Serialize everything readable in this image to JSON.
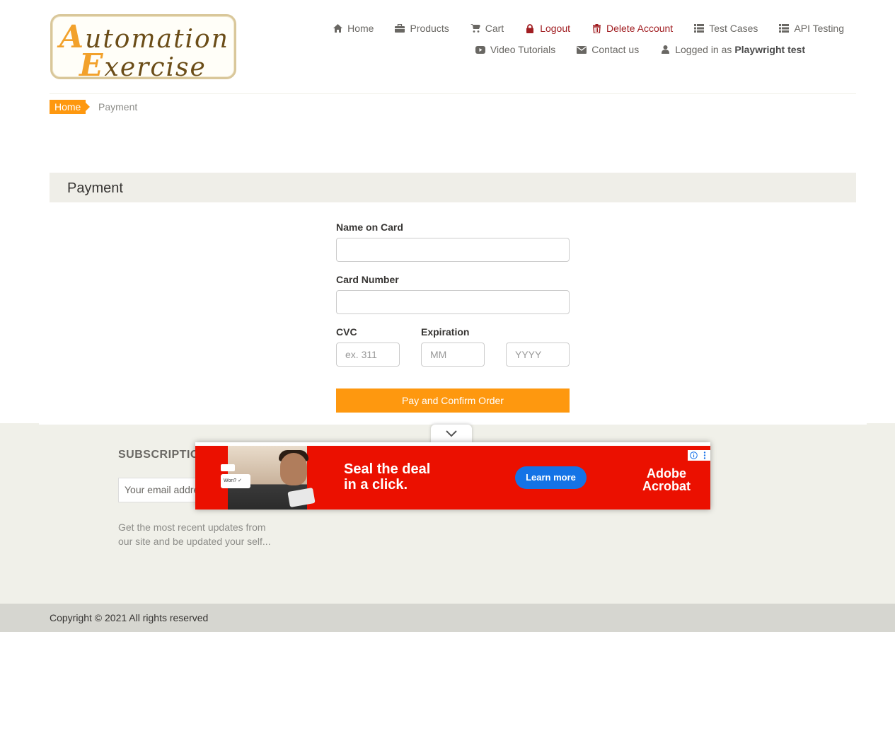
{
  "logo": {
    "line1_cap": "A",
    "line1_rest": "utomation",
    "line2_cap": "E",
    "line2_rest": "xercise"
  },
  "nav": {
    "row1": [
      {
        "label": "Home",
        "icon": "home-icon"
      },
      {
        "label": "Products",
        "icon": "briefcase-icon"
      },
      {
        "label": "Cart",
        "icon": "cart-icon"
      },
      {
        "label": "Logout",
        "icon": "lock-icon"
      },
      {
        "label": "Delete Account",
        "icon": "trash-icon"
      },
      {
        "label": "Test Cases",
        "icon": "list-icon"
      },
      {
        "label": "API Testing",
        "icon": "list-icon"
      }
    ],
    "row2": [
      {
        "label": "Video Tutorials",
        "icon": "youtube-icon"
      },
      {
        "label": "Contact us",
        "icon": "envelope-icon"
      },
      {
        "label": "Logged in as",
        "user": "Playwright test",
        "icon": "user-icon"
      }
    ]
  },
  "breadcrumb": {
    "home": "Home",
    "current": "Payment"
  },
  "payment": {
    "heading": "Payment",
    "name_label": "Name on Card",
    "card_label": "Card Number",
    "cvc_label": "CVC",
    "cvc_placeholder": "ex. 311",
    "exp_label": "Expiration",
    "month_placeholder": "MM",
    "year_placeholder": "YYYY",
    "submit": "Pay and Confirm Order"
  },
  "footer": {
    "subscription_title": "SUBSCRIPTIO",
    "email_placeholder": "Your email addre",
    "subscription_text": "Get the most recent updates from our site and be updated your self...",
    "copyright": "Copyright © 2021 All rights reserved"
  },
  "ad": {
    "headline_1": "Seal the deal",
    "headline_2": "in a click.",
    "cta": "Learn more",
    "brand_1": "Adobe",
    "brand_2": "Acrobat",
    "card_text": "Won? ✓"
  },
  "colors": {
    "accent": "#fe980f",
    "danger": "#a11e22",
    "ad_red": "#eb1000",
    "ad_blue": "#1473e6"
  }
}
